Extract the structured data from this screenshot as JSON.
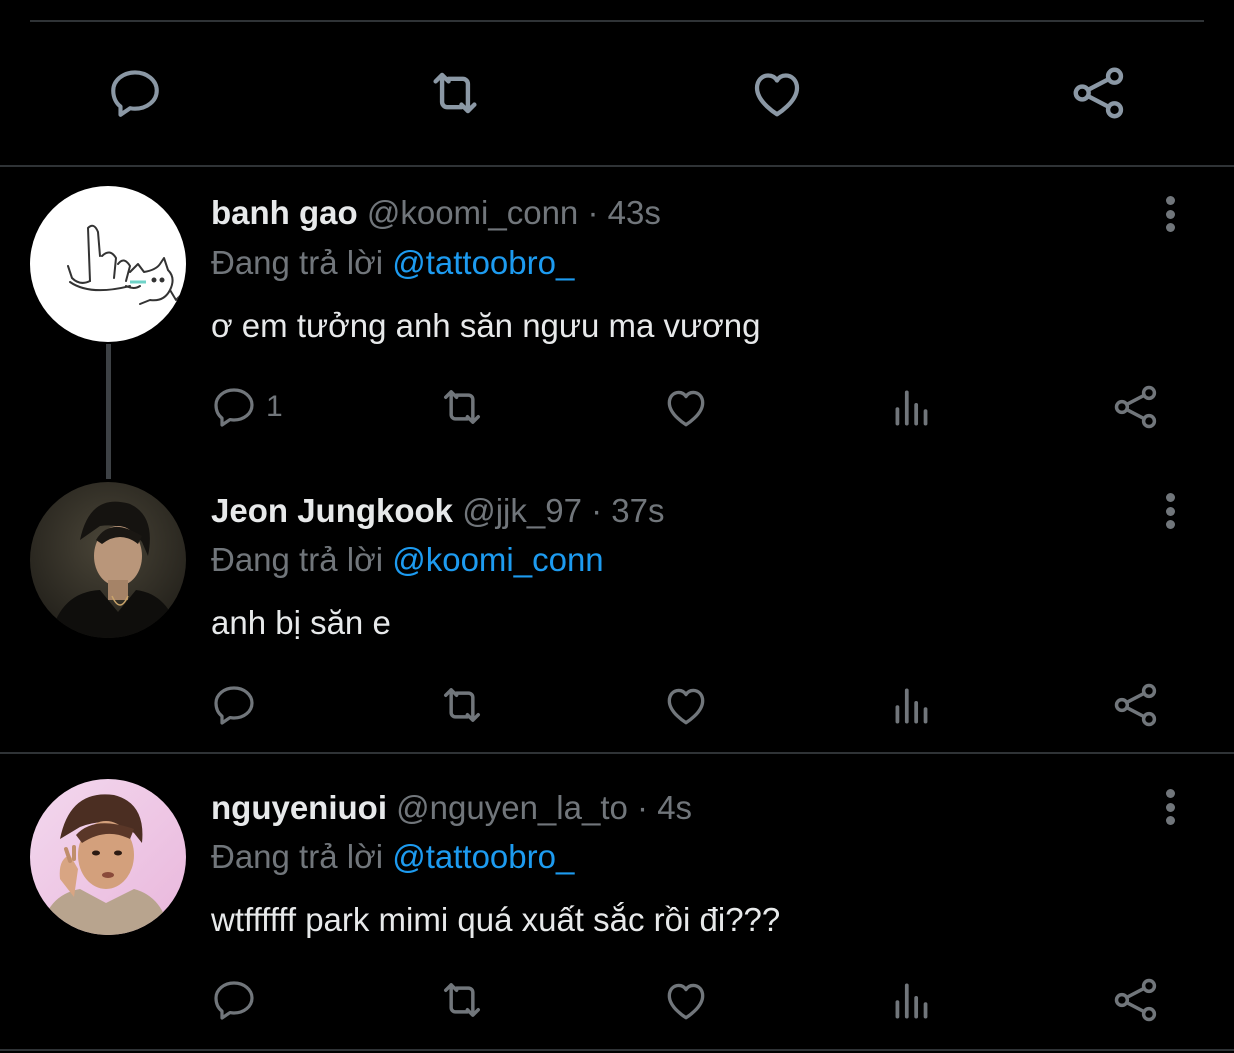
{
  "colors": {
    "background": "#000000",
    "text": "#e7e9ea",
    "muted": "#71767b",
    "link": "#1d9bf0",
    "divider": "#2f3336"
  },
  "main_tweet_actions": {
    "icons": [
      "reply-icon",
      "retweet-icon",
      "like-icon",
      "share-icon"
    ]
  },
  "replies": [
    {
      "name": "banh gao",
      "handle": "@koomi_conn",
      "time": "· 43s",
      "reply_prefix": "Đang trả lời",
      "reply_to": "@tattoobro_",
      "text": "ơ em tưởng anh săn ngưu ma vương",
      "reply_count": "1",
      "avatar": "cat-doodle-avatar"
    },
    {
      "name": "Jeon Jungkook",
      "handle": "@jjk_97",
      "time": "· 37s",
      "reply_prefix": "Đang trả lời",
      "reply_to": "@koomi_conn",
      "text": "anh bị săn e",
      "reply_count": "",
      "avatar": "person-photo-avatar"
    },
    {
      "name": "nguyeniuoi",
      "handle": "@nguyen_la_to",
      "time": "· 4s",
      "reply_prefix": "Đang trả lời",
      "reply_to": "@tattoobro_",
      "text": "wtffffff park mimi quá xuất sắc rồi đi???",
      "reply_count": "",
      "avatar": "person-photo-avatar"
    }
  ]
}
